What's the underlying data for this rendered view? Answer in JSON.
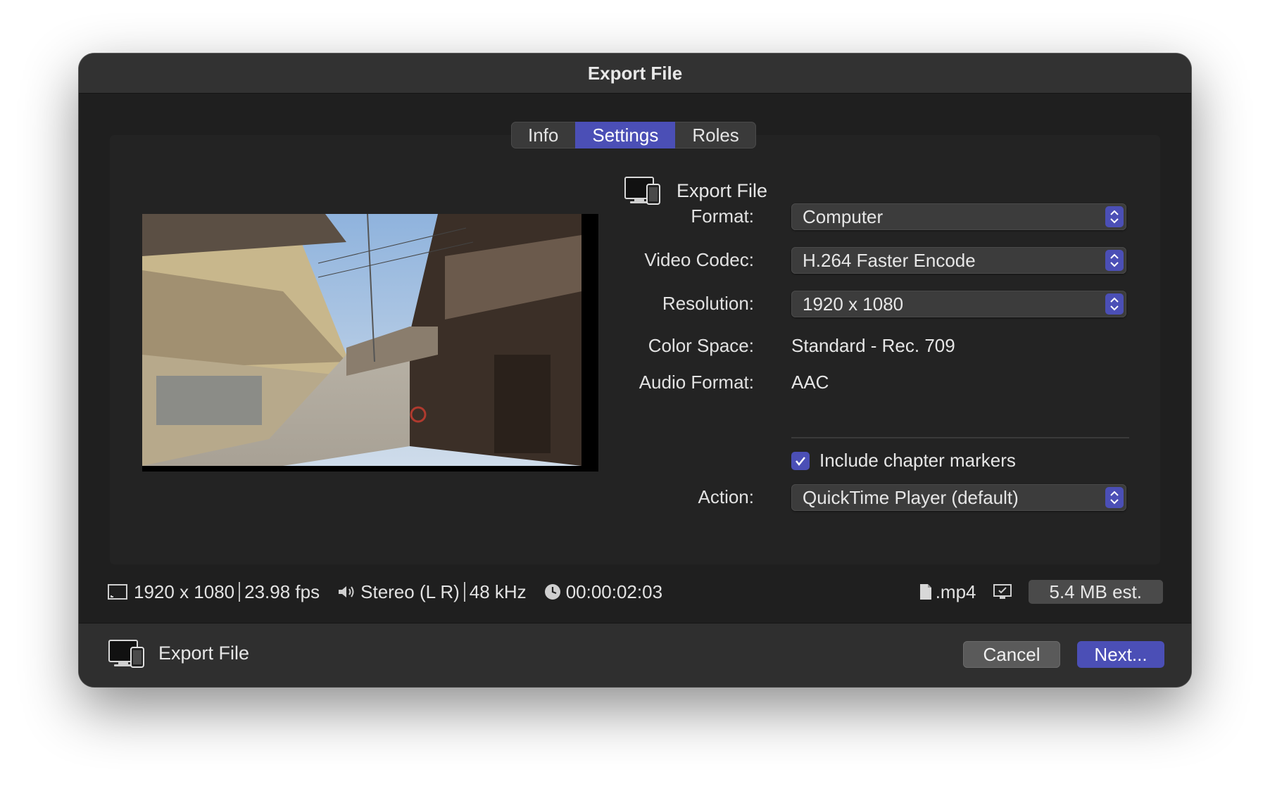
{
  "window": {
    "title": "Export File"
  },
  "tabs": [
    {
      "label": "Info",
      "active": false
    },
    {
      "label": "Settings",
      "active": true
    },
    {
      "label": "Roles",
      "active": false
    }
  ],
  "destination": {
    "label": "Export File",
    "icon": "computer-device-icon"
  },
  "settings": {
    "format": {
      "label": "Format:",
      "value": "Computer"
    },
    "video_codec": {
      "label": "Video Codec:",
      "value": "H.264 Faster Encode"
    },
    "resolution": {
      "label": "Resolution:",
      "value": "1920 x 1080"
    },
    "color_space": {
      "label": "Color Space:",
      "value": "Standard - Rec. 709"
    },
    "audio_format": {
      "label": "Audio Format:",
      "value": "AAC"
    },
    "chapter_markers": {
      "label": "Include chapter markers",
      "checked": true
    },
    "action": {
      "label": "Action:",
      "value": "QuickTime Player (default)"
    }
  },
  "status": {
    "resolution": "1920 x 1080",
    "fps": "23.98 fps",
    "audio": "Stereo (L R)",
    "sample_rate": "48 kHz",
    "duration": "00:00:02:03",
    "extension": ".mp4",
    "size_estimate": "5.4 MB est."
  },
  "footer": {
    "destination_label": "Export File",
    "cancel_label": "Cancel",
    "next_label": "Next..."
  },
  "colors": {
    "accent": "#4b4fb6",
    "window_bg": "#1f1f1f",
    "titlebar_bg": "#323232"
  }
}
